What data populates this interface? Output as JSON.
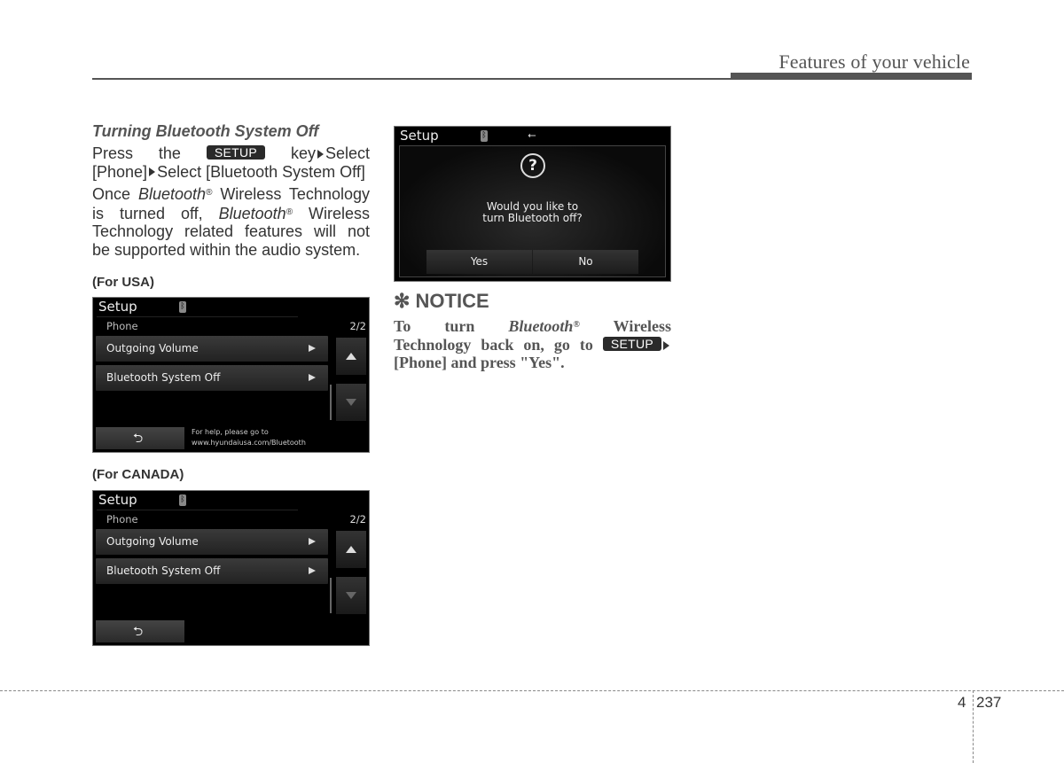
{
  "header": {
    "section_title": "Features of your vehicle"
  },
  "left": {
    "heading": "Turning Bluetooth System Off",
    "instr": {
      "press": "Press",
      "the": "the",
      "key_label": "SETUP",
      "key_suffix": "key",
      "select1": "Select",
      "phone": "[Phone]",
      "select2": "Select [Bluetooth System Off]"
    },
    "para2": {
      "once": "Once ",
      "bluetooth": "Bluetooth",
      "reg": "®",
      "rest1": " Wireless Technology",
      "is_off": "is turned off, ",
      "rest2": " Wireless",
      "line3": "Technology related features will not",
      "line4": "be supported within the audio system."
    }
  },
  "captions": {
    "usa": "(For USA)",
    "canada": "(For CANADA)"
  },
  "screen_usa": {
    "title": "Setup",
    "bt_icon": "bluetooth-icon",
    "subtitle": "Phone",
    "page": "2/2",
    "items": [
      {
        "label": "Outgoing Volume"
      },
      {
        "label": "Bluetooth System Off"
      }
    ],
    "back_glyph": "⮌",
    "help_line1": "For help, please go to",
    "help_line2": "www.hyundaiusa.com/Bluetooth"
  },
  "screen_canada": {
    "title": "Setup",
    "subtitle": "Phone",
    "page": "2/2",
    "items": [
      {
        "label": "Outgoing Volume"
      },
      {
        "label": "Bluetooth System Off"
      }
    ],
    "back_glyph": "⮌"
  },
  "screen_dialog": {
    "title": "Setup",
    "usb_glyph": "⭠",
    "question_glyph": "?",
    "message_line1": "Would you like to",
    "message_line2": "turn Bluetooth off?",
    "yes": "Yes",
    "no": "No"
  },
  "notice": {
    "title": "✻ NOTICE",
    "to_turn": "To turn",
    "bluetooth": "Bluetooth",
    "reg": "®",
    "wireless": "Wireless",
    "line2": "Technology back on, go to",
    "key_label": "SETUP",
    "line3": "[Phone] and press \"Yes\"."
  },
  "footer": {
    "chapter": "4",
    "page": "237"
  }
}
